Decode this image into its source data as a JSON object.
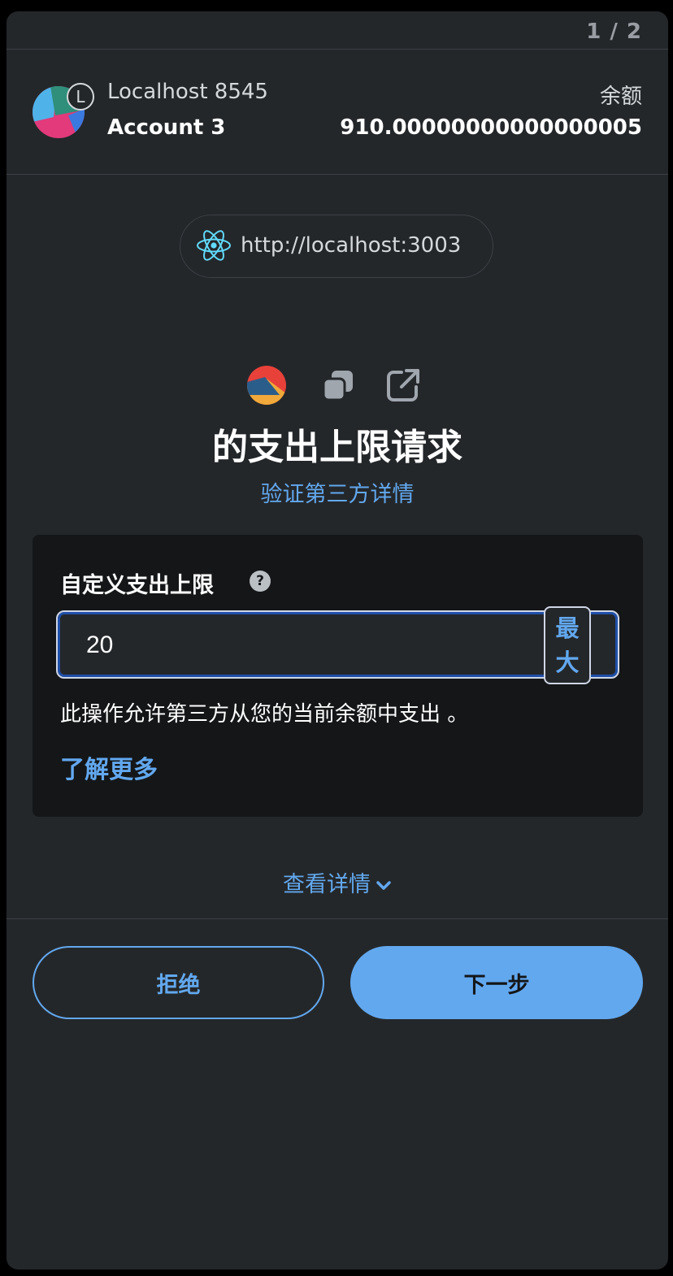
{
  "pager": {
    "text": "1 / 2"
  },
  "account": {
    "network_name": "Localhost 8545",
    "network_badge_letter": "L",
    "account_name": "Account 3",
    "balance_label": "余额",
    "balance_value": "910.00000000000000005"
  },
  "origin": {
    "url": "http://localhost:3003",
    "icon": "react-icon"
  },
  "request": {
    "title": "的支出上限请求",
    "verify_link": "验证第三方详情"
  },
  "spending_cap": {
    "label": "自定义支出上限",
    "help_icon_text": "?",
    "input_value": "20",
    "max_button_chars": [
      "最",
      "大"
    ],
    "description": "此操作允许第三方从您的当前余额中支出 。",
    "learn_more": "了解更多"
  },
  "details": {
    "toggle_label": "查看详情"
  },
  "footer": {
    "reject_label": "拒绝",
    "next_label": "下一步"
  },
  "colors": {
    "accent": "#62a8ef",
    "background": "#24272a",
    "card": "#141618"
  }
}
